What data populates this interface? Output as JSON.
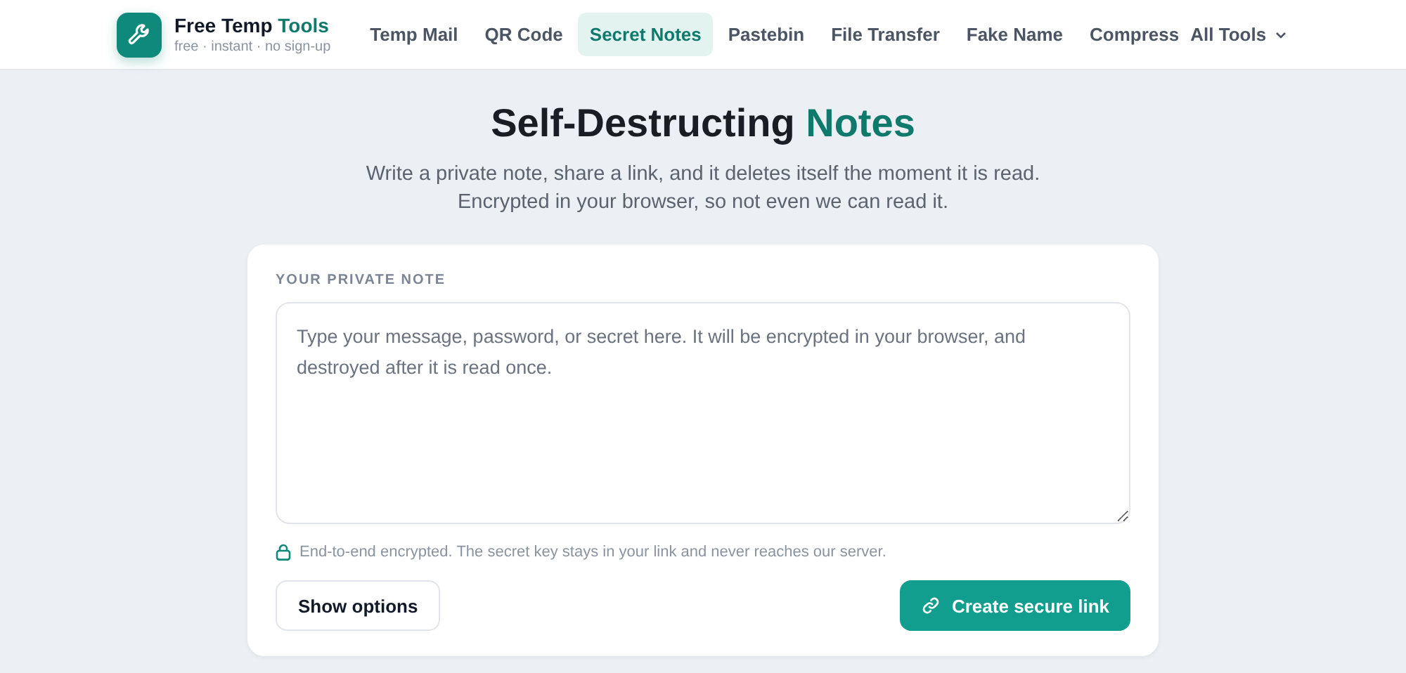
{
  "header": {
    "brand_name": "Free Temp",
    "brand_accent": "Tools",
    "tagline": "free · instant · no sign-up",
    "nav": [
      {
        "label": "Temp Mail",
        "selected": false
      },
      {
        "label": "QR Code",
        "selected": false
      },
      {
        "label": "Secret Notes",
        "selected": true
      },
      {
        "label": "Pastebin",
        "selected": false
      },
      {
        "label": "File Transfer",
        "selected": false
      },
      {
        "label": "Fake Name",
        "selected": false
      },
      {
        "label": "Compress",
        "selected": false
      }
    ],
    "menu": "All Tools"
  },
  "hero": {
    "title": "Self-Destructing",
    "title_accent": "Notes",
    "subtitle": [
      "Write a private note, share a link, and it deletes itself the moment it is read.",
      "Encrypted in your browser, so not even we can read it."
    ]
  },
  "card": {
    "label": "YOUR PRIVATE NOTE",
    "placeholder": "Type your message, password, or secret here. It will be encrypted in your browser, and destroyed after it is read once.",
    "note": "End-to-end encrypted. The secret key stays in your link and never reaches our server.",
    "secondary_button": "Show options",
    "primary_button": "Create secure link"
  }
}
